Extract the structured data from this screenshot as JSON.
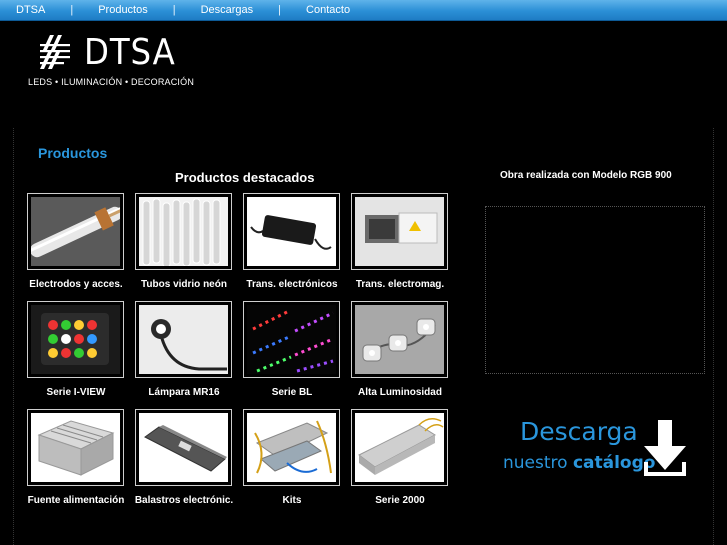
{
  "nav": {
    "items": [
      "DTSA",
      "Productos",
      "Descargas",
      "Contacto"
    ],
    "separator": "|"
  },
  "logo": {
    "wordmark": "DTSA",
    "tagline": "LEDS • ILUMINACIÓN • DECORACIÓN"
  },
  "section_title": "Productos",
  "featured_title": "Productos destacados",
  "products": [
    {
      "label": "Electrodos y acces.",
      "icon": "electrode-tube-photo"
    },
    {
      "label": "Tubos vidrio neón",
      "icon": "neon-glass-tubes-photo"
    },
    {
      "label": "Trans. electrónicos",
      "icon": "electronic-transformer-photo"
    },
    {
      "label": "Trans. electromag.",
      "icon": "electromagnetic-transformer-photo"
    },
    {
      "label": "Serie I-VIEW",
      "icon": "rgb-led-floodlight-photo"
    },
    {
      "label": "Lámpara MR16",
      "icon": "mr16-lamp-photo"
    },
    {
      "label": "Serie BL",
      "icon": "led-strips-photo"
    },
    {
      "label": "Alta Luminosidad",
      "icon": "high-brightness-led-modules-photo"
    },
    {
      "label": "Fuente alimentación",
      "icon": "power-supply-photo"
    },
    {
      "label": "Balastros electrónic.",
      "icon": "electronic-ballast-photo"
    },
    {
      "label": "Kits",
      "icon": "kits-photo"
    },
    {
      "label": "Serie 2000",
      "icon": "series-2000-driver-photo"
    }
  ],
  "obra_title": "Obra realizada con Modelo RGB 900",
  "catalog": {
    "line1": "Descarga",
    "line2_prefix": "nuestro",
    "line2_bold": "catálogo",
    "icon": "download-arrow-icon"
  },
  "colors": {
    "nav_bar": "#2b8fd6",
    "accent_blue": "#2a96dc",
    "background": "#000000"
  }
}
